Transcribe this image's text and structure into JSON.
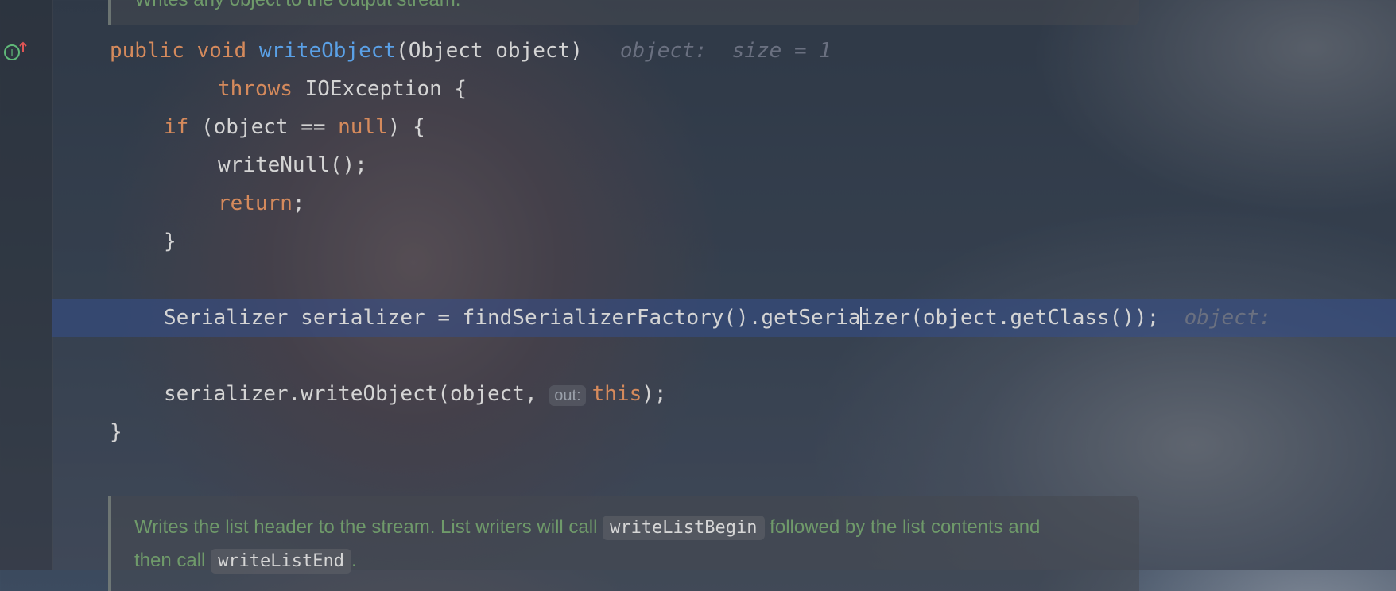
{
  "doc_top": {
    "text": "Writes any object to the output stream."
  },
  "code": {
    "l1": {
      "public": "public",
      "void": "void",
      "method": "writeObject",
      "params": "(Object object)",
      "hint": "object:  size = 1"
    },
    "l2": {
      "throws": "throws",
      "rest": " IOException {"
    },
    "l3": {
      "if": "if",
      "rest1": " (object == ",
      "null": "null",
      "rest2": ") {"
    },
    "l4": {
      "text": "writeNull();"
    },
    "l5": {
      "return": "return",
      "semi": ";"
    },
    "l6": {
      "text": "}"
    },
    "l7": {
      "before": "Serializer serializer = findSerializerFactory().getSeria",
      "after": "izer(object.getClass());",
      "hint": "object:"
    },
    "l8": {
      "before": "serializer.writeObject(object, ",
      "inlay": "out:",
      "this": "this",
      "end": ");"
    },
    "l9": {
      "text": "}"
    }
  },
  "doc_bottom": {
    "line1_a": "Writes the list header to the stream. List writers will call ",
    "chip1": "writeListBegin",
    "line1_b": " followed by the list contents and",
    "line2_a": "then call ",
    "chip2": "writeListEnd",
    "line2_b": "."
  },
  "colors": {
    "keyword": "#d58a5c",
    "method": "#5aa0e6",
    "doc": "#6f9a6a",
    "highlight": "#344e8c"
  }
}
